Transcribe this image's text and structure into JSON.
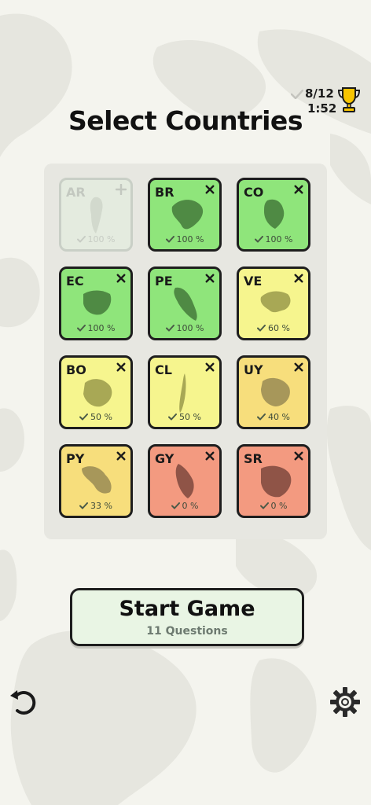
{
  "header": {
    "score": "8/12",
    "time": "1:52",
    "title": "Select Countries"
  },
  "colors": {
    "green": "#8fe57b",
    "yellow": "#f2f28b",
    "orange": "#f7de7c",
    "red": "#f39a80",
    "disabled": "#e4ebdf"
  },
  "tiles": [
    {
      "code": "AR",
      "percent": "100 %",
      "state": "disabled",
      "action": "plus-icon"
    },
    {
      "code": "BR",
      "percent": "100 %",
      "state": "green",
      "action": "close-icon"
    },
    {
      "code": "CO",
      "percent": "100 %",
      "state": "green",
      "action": "close-icon"
    },
    {
      "code": "EC",
      "percent": "100 %",
      "state": "green",
      "action": "close-icon"
    },
    {
      "code": "PE",
      "percent": "100 %",
      "state": "green",
      "action": "close-icon"
    },
    {
      "code": "VE",
      "percent": "60 %",
      "state": "yellow",
      "action": "close-icon"
    },
    {
      "code": "BO",
      "percent": "50 %",
      "state": "yellow",
      "action": "close-icon"
    },
    {
      "code": "CL",
      "percent": "50 %",
      "state": "yellow",
      "action": "close-icon"
    },
    {
      "code": "UY",
      "percent": "40 %",
      "state": "orange",
      "action": "close-icon"
    },
    {
      "code": "PY",
      "percent": "33 %",
      "state": "orange",
      "action": "close-icon"
    },
    {
      "code": "GY",
      "percent": "0 %",
      "state": "red",
      "action": "close-icon"
    },
    {
      "code": "SR",
      "percent": "0 %",
      "state": "red",
      "action": "close-icon"
    }
  ],
  "start_button": {
    "label": "Start Game",
    "sub": "11 Questions"
  },
  "footer": {
    "left_icon": "undo-icon",
    "right_icon": "gear-icon"
  }
}
